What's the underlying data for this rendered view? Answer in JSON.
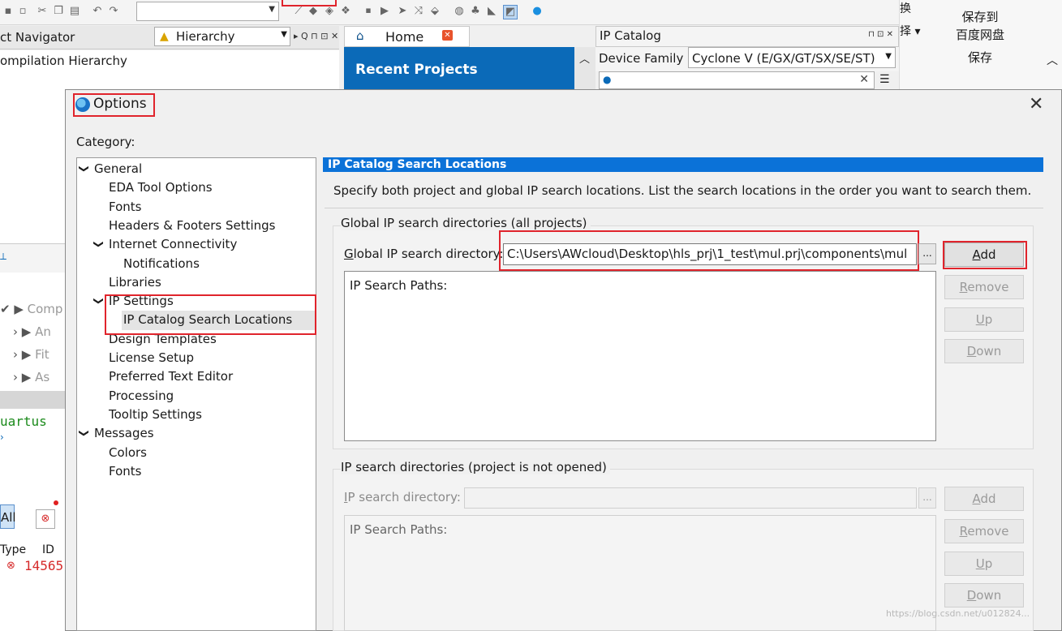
{
  "toolbar": {
    "icons": [
      "save-icon",
      "cut-icon",
      "copy-icon",
      "paste-icon",
      "undo-icon",
      "redo-icon",
      "compile-icon",
      "stop-icon",
      "start-icon",
      "analysis-icon",
      "timing-icon",
      "chip-planner-icon",
      "programmer-icon",
      "ip-catalog-icon",
      "help-icon"
    ]
  },
  "navigator": {
    "title": "ct Navigator",
    "hierarchy_combo": "Hierarchy",
    "subtitle": "ompilation Hierarchy"
  },
  "home_tab": {
    "label": "Home"
  },
  "recent_projects": {
    "label": "Recent Projects"
  },
  "ip_catalog": {
    "title": "IP Catalog",
    "device_family_label": "Device Family",
    "device_family_value": "Cyclone V (E/GX/GT/SX/SE/ST)"
  },
  "ribbon": {
    "save_to": "保存到",
    "baidu": "百度网盘",
    "save": "保存",
    "frag1": "换",
    "frag2": "择 ▾"
  },
  "left_fragments": {
    "comp": "Comp",
    "an": "An",
    "fit": "Fit",
    "as": "As",
    "quartus": "uartus",
    "all": "All",
    "type": "Type",
    "id": "ID",
    "num": "14565"
  },
  "dialog": {
    "title": "Options",
    "category_label": "Category:",
    "tree": [
      {
        "label": "General",
        "level": 0,
        "expanded": true
      },
      {
        "label": "EDA Tool Options",
        "level": 1
      },
      {
        "label": "Fonts",
        "level": 1
      },
      {
        "label": "Headers & Footers Settings",
        "level": 1
      },
      {
        "label": "Internet Connectivity",
        "level": 1,
        "expanded": true
      },
      {
        "label": "Notifications",
        "level": 2
      },
      {
        "label": "Libraries",
        "level": 1
      },
      {
        "label": "IP Settings",
        "level": 1,
        "expanded": true
      },
      {
        "label": "IP Catalog Search Locations",
        "level": 2,
        "selected": true
      },
      {
        "label": "Design Templates",
        "level": 1
      },
      {
        "label": "License Setup",
        "level": 1
      },
      {
        "label": "Preferred Text Editor",
        "level": 1
      },
      {
        "label": "Processing",
        "level": 1
      },
      {
        "label": "Tooltip Settings",
        "level": 1
      },
      {
        "label": "Messages",
        "level": 0,
        "expanded": true
      },
      {
        "label": "Colors",
        "level": 1
      },
      {
        "label": "Fonts",
        "level": 1
      }
    ],
    "page_header": "IP Catalog Search Locations",
    "description": "Specify both project and global IP search locations. List the search locations in the order you want to search them.",
    "global_group": {
      "title": "Global IP search directories (all projects)",
      "dir_label": "Global IP search directory:",
      "dir_accel_index": 0,
      "dir_value": "C:\\Users\\AWcloud\\Desktop\\hls_prj\\1_test\\mul.prj\\components\\mul",
      "browse": "...",
      "paths_label": "IP Search Paths:",
      "buttons": [
        {
          "label": "Add",
          "accel_index": 0,
          "enabled": true
        },
        {
          "label": "Remove",
          "accel_index": 0,
          "enabled": false
        },
        {
          "label": "Up",
          "accel_index": 0,
          "enabled": false
        },
        {
          "label": "Down",
          "accel_index": 0,
          "enabled": false
        }
      ]
    },
    "project_group": {
      "title": "IP search directories (project is not opened)",
      "dir_label": "IP search directory:",
      "dir_accel_index": 0,
      "dir_value": "",
      "browse": "...",
      "paths_label": "IP Search Paths:",
      "buttons": [
        {
          "label": "Add",
          "accel_index": 0,
          "enabled": false
        },
        {
          "label": "Remove",
          "accel_index": 0,
          "enabled": false
        },
        {
          "label": "Up",
          "accel_index": 0,
          "enabled": false
        },
        {
          "label": "Down",
          "accel_index": 0,
          "enabled": false
        }
      ]
    }
  },
  "colors": {
    "accent": "#0b72d8",
    "highlight": "#e0242c",
    "recent_bg": "#0b6ab8"
  },
  "watermark": "https://blog.csdn.net/u012824..."
}
